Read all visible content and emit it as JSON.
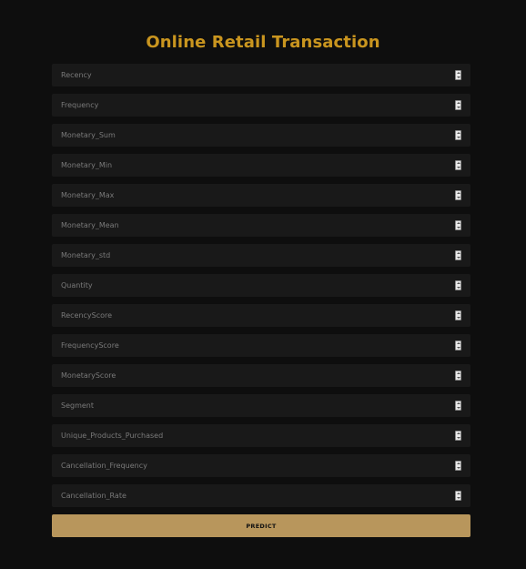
{
  "page": {
    "title": "Online Retail Transaction"
  },
  "form": {
    "fields": [
      {
        "placeholder": "Recency",
        "value": ""
      },
      {
        "placeholder": "Frequency",
        "value": ""
      },
      {
        "placeholder": "Monetary_Sum",
        "value": ""
      },
      {
        "placeholder": "Monetary_Min",
        "value": ""
      },
      {
        "placeholder": "Monetary_Max",
        "value": ""
      },
      {
        "placeholder": "Monetary_Mean",
        "value": ""
      },
      {
        "placeholder": "Monetary_std",
        "value": ""
      },
      {
        "placeholder": "Quantity",
        "value": ""
      },
      {
        "placeholder": "RecencyScore",
        "value": ""
      },
      {
        "placeholder": "FrequencyScore",
        "value": ""
      },
      {
        "placeholder": "MonetaryScore",
        "value": ""
      },
      {
        "placeholder": "Segment",
        "value": ""
      },
      {
        "placeholder": "Unique_Products_Purchased",
        "value": ""
      },
      {
        "placeholder": "Cancellation_Frequency",
        "value": ""
      },
      {
        "placeholder": "Cancellation_Rate",
        "value": ""
      }
    ],
    "submit_label": "PREDICT"
  },
  "colors": {
    "background": "#0e0e0e",
    "title": "#c9951f",
    "field_bg": "#191919",
    "placeholder": "#7a7a7a",
    "button_bg": "#b8965c",
    "button_text": "#111111"
  },
  "icons": {
    "field_control": "number-spinner-icon"
  }
}
